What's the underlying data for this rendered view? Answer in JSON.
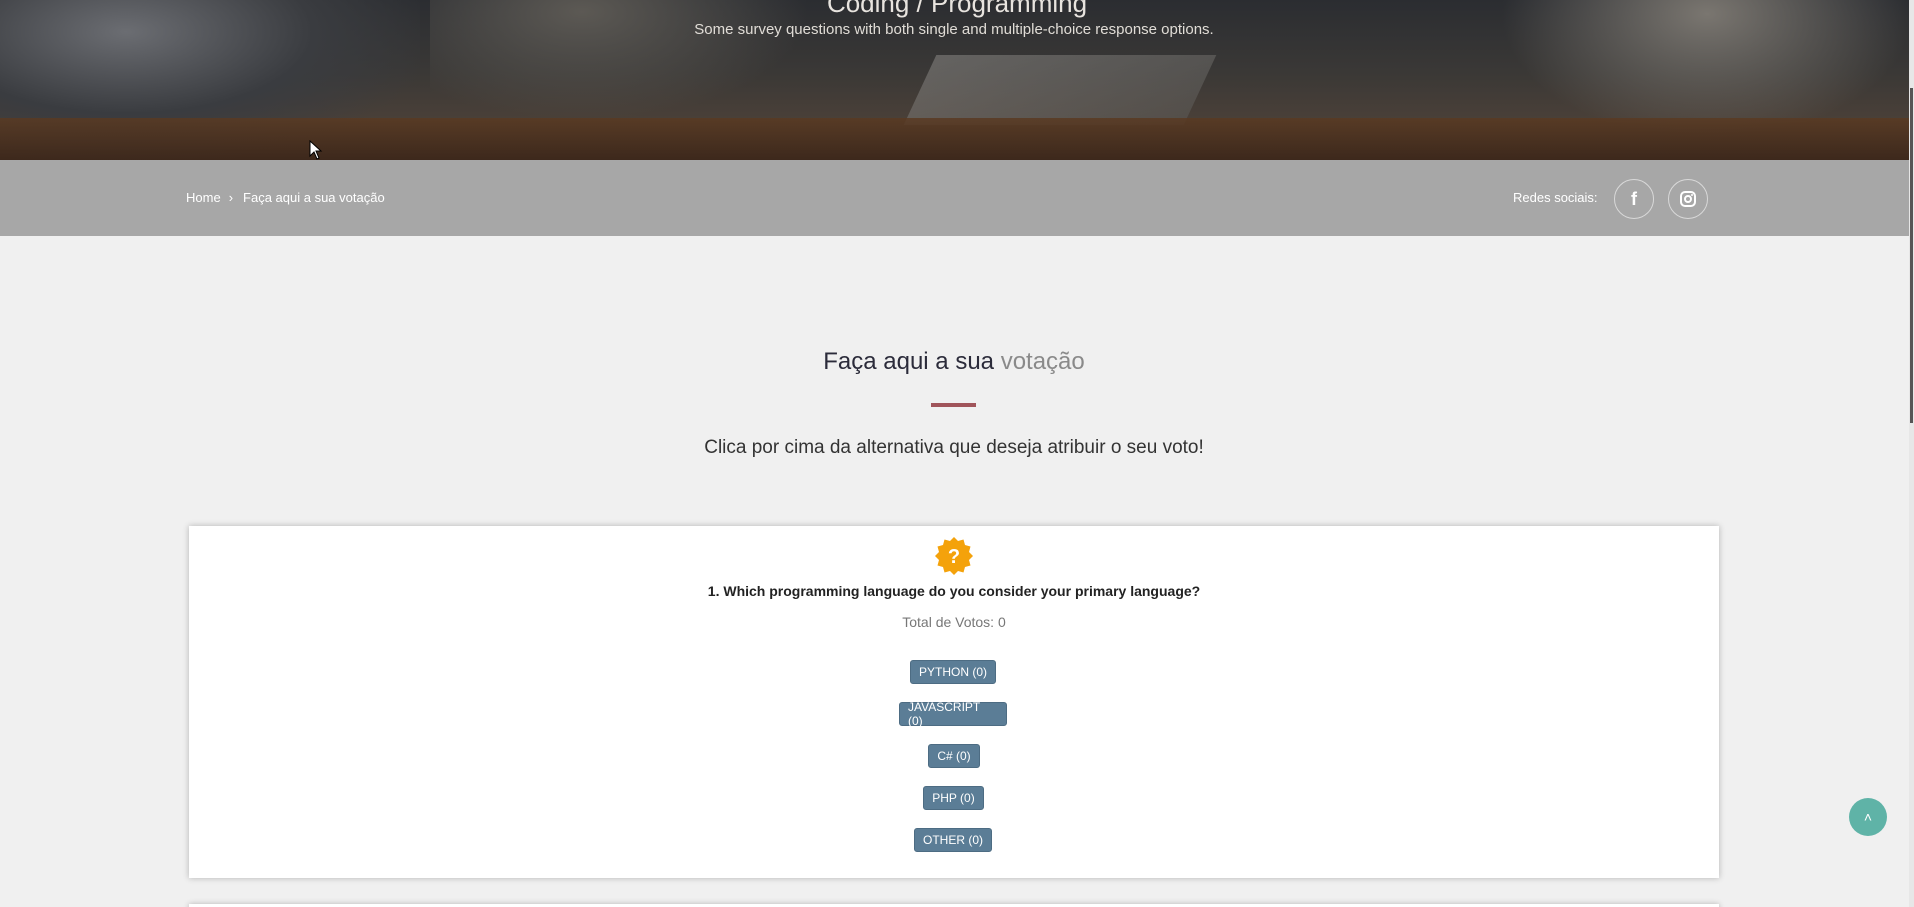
{
  "hero": {
    "title": "Coding / Programming",
    "subtitle": "Some survey questions with both single and multiple-choice response options."
  },
  "breadcrumb": {
    "home": "Home",
    "current": "Faça aqui a sua votação"
  },
  "social": {
    "label": "Redes sociais:",
    "facebook_icon": "facebook-icon",
    "instagram_icon": "instagram-icon"
  },
  "section": {
    "title_main": "Faça aqui a sua",
    "title_accent": "votação",
    "subtitle": "Clica por cima da alternativa que deseja atribuir o seu voto!",
    "divider_color": "#a0545a"
  },
  "question": {
    "icon": "question-badge-icon",
    "icon_color": "#f4a20b",
    "text": "1. Which programming language do you consider your primary language?",
    "total": "Total de Votos: 0",
    "options": [
      {
        "label": "PYTHON (0)"
      },
      {
        "label": "JAVASCRIPT (0)"
      },
      {
        "label": "C# (0)"
      },
      {
        "label": "PHP (0)"
      },
      {
        "label": "OTHER (0)"
      }
    ]
  },
  "colors": {
    "option_button": "#5b7d96",
    "back_to_top": "#5fb3a7",
    "breadcrumb_bar": "#a7a7a7"
  }
}
